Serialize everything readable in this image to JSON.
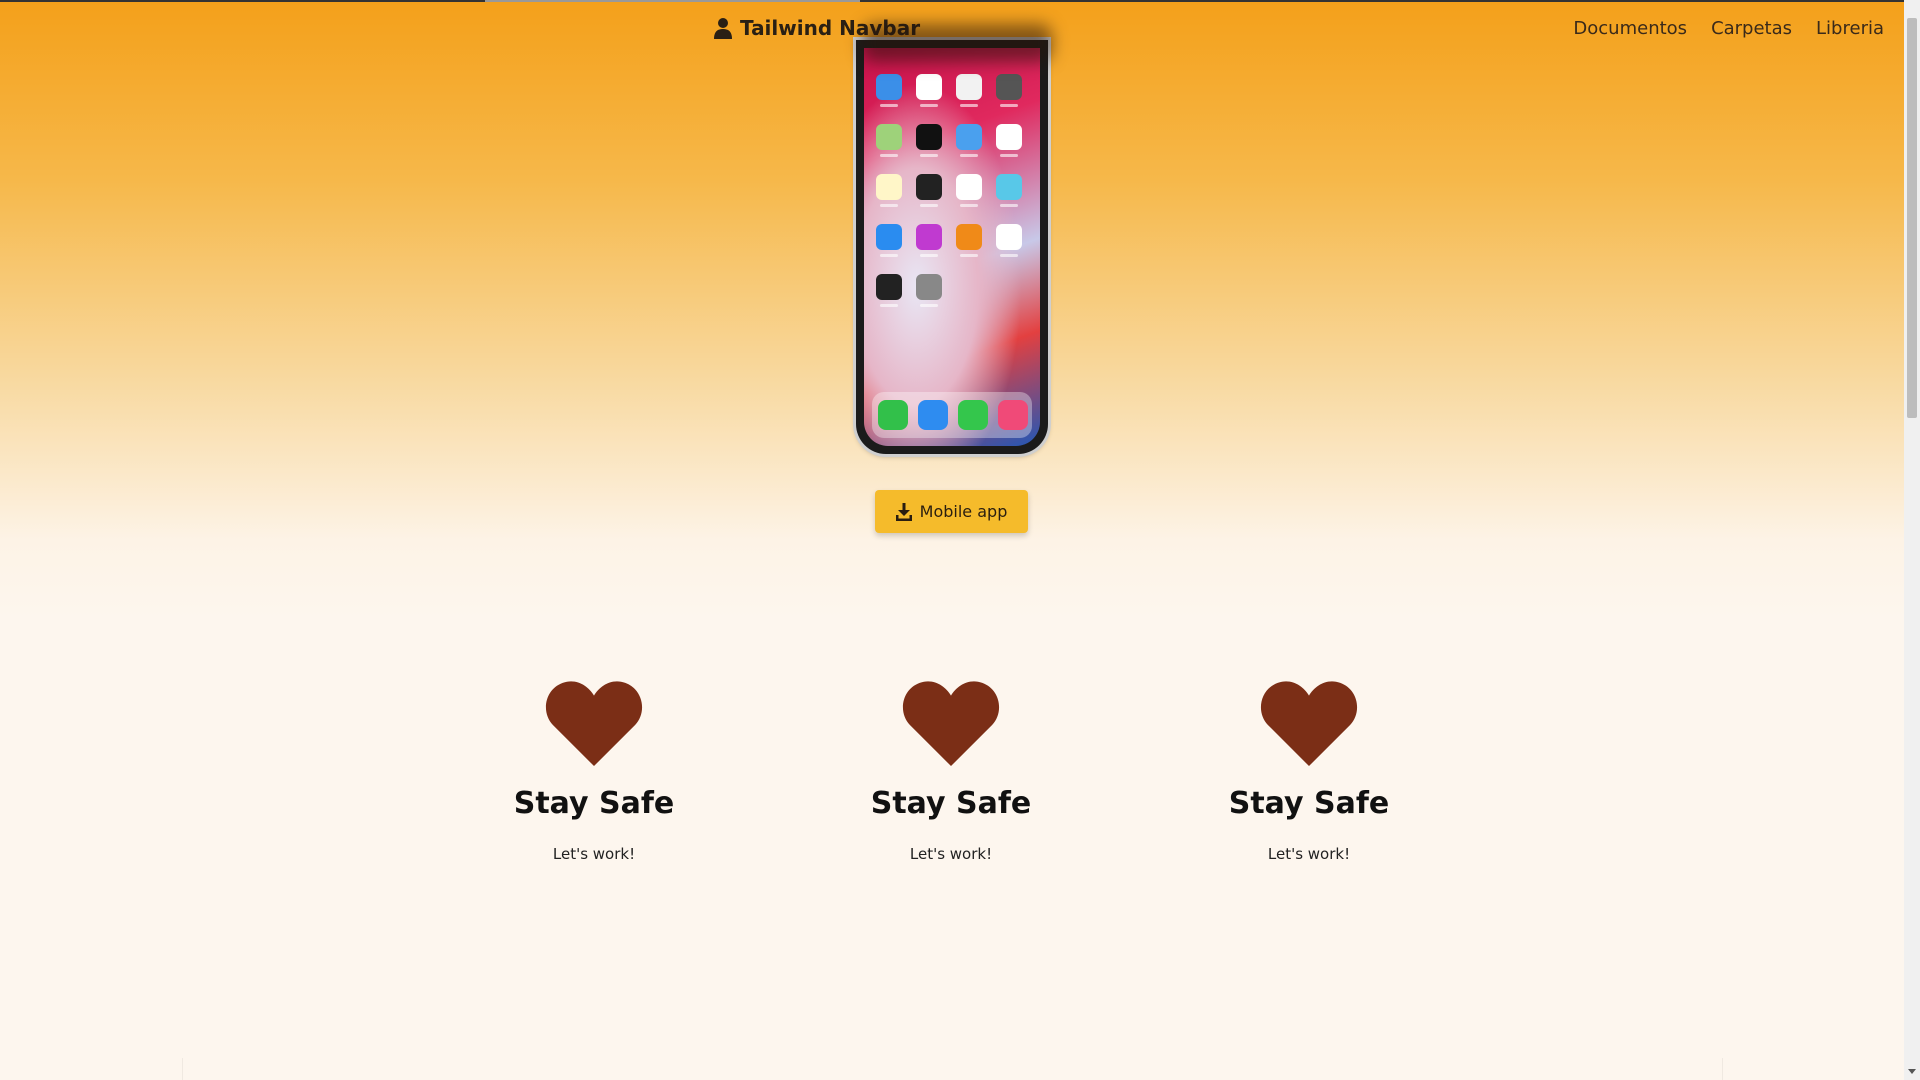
{
  "navbar": {
    "brand": "Tailwind Navbar",
    "brand_icon": "user-icon",
    "links": [
      "Documentos",
      "Carpetas",
      "Libreria"
    ]
  },
  "hero": {
    "image": "phone-mockup",
    "download_button": {
      "label": "Mobile app",
      "icon": "download-icon"
    }
  },
  "features": [
    {
      "icon": "heart-icon",
      "title": "Stay Safe",
      "text": "Let's work!"
    },
    {
      "icon": "heart-icon",
      "title": "Stay Safe",
      "text": "Let's work!"
    },
    {
      "icon": "heart-icon",
      "title": "Stay Safe",
      "text": "Let's work!"
    }
  ],
  "colors": {
    "header_orange": "#f4a01a",
    "page_bg": "#fdf6ee",
    "button": "#f5bb2b",
    "heart": "#7b2e16"
  }
}
